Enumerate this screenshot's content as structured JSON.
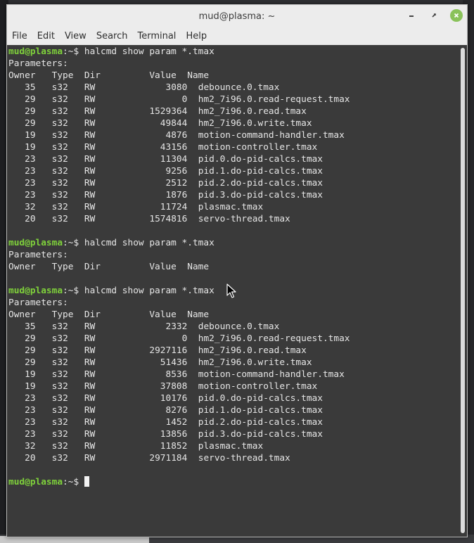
{
  "window": {
    "title": "mud@plasma: ~"
  },
  "menu": [
    "File",
    "Edit",
    "View",
    "Search",
    "Terminal",
    "Help"
  ],
  "prompt": {
    "user_host": "mud@plasma",
    "path": ":~$ "
  },
  "blocks": [
    {
      "command": "halcmd show param *.tmax",
      "params_label": "Parameters:",
      "header": "Owner   Type  Dir         Value  Name",
      "rows": [
        {
          "owner": "35",
          "type": "s32",
          "dir": "RW",
          "value": "3080",
          "name": "debounce.0.tmax"
        },
        {
          "owner": "29",
          "type": "s32",
          "dir": "RW",
          "value": "0",
          "name": "hm2_7i96.0.read-request.tmax"
        },
        {
          "owner": "29",
          "type": "s32",
          "dir": "RW",
          "value": "1529364",
          "name": "hm2_7i96.0.read.tmax"
        },
        {
          "owner": "29",
          "type": "s32",
          "dir": "RW",
          "value": "49844",
          "name": "hm2_7i96.0.write.tmax"
        },
        {
          "owner": "19",
          "type": "s32",
          "dir": "RW",
          "value": "4876",
          "name": "motion-command-handler.tmax"
        },
        {
          "owner": "19",
          "type": "s32",
          "dir": "RW",
          "value": "43156",
          "name": "motion-controller.tmax"
        },
        {
          "owner": "23",
          "type": "s32",
          "dir": "RW",
          "value": "11304",
          "name": "pid.0.do-pid-calcs.tmax"
        },
        {
          "owner": "23",
          "type": "s32",
          "dir": "RW",
          "value": "9256",
          "name": "pid.1.do-pid-calcs.tmax"
        },
        {
          "owner": "23",
          "type": "s32",
          "dir": "RW",
          "value": "2512",
          "name": "pid.2.do-pid-calcs.tmax"
        },
        {
          "owner": "23",
          "type": "s32",
          "dir": "RW",
          "value": "1876",
          "name": "pid.3.do-pid-calcs.tmax"
        },
        {
          "owner": "32",
          "type": "s32",
          "dir": "RW",
          "value": "11724",
          "name": "plasmac.tmax"
        },
        {
          "owner": "20",
          "type": "s32",
          "dir": "RW",
          "value": "1574816",
          "name": "servo-thread.tmax"
        }
      ]
    },
    {
      "command": "halcmd show param *.tmax",
      "params_label": "Parameters:",
      "header": "Owner   Type  Dir         Value  Name",
      "rows": []
    },
    {
      "command": "halcmd show param *.tmax",
      "params_label": "Parameters:",
      "header": "Owner   Type  Dir         Value  Name",
      "rows": [
        {
          "owner": "35",
          "type": "s32",
          "dir": "RW",
          "value": "2332",
          "name": "debounce.0.tmax"
        },
        {
          "owner": "29",
          "type": "s32",
          "dir": "RW",
          "value": "0",
          "name": "hm2_7i96.0.read-request.tmax"
        },
        {
          "owner": "29",
          "type": "s32",
          "dir": "RW",
          "value": "2927116",
          "name": "hm2_7i96.0.read.tmax"
        },
        {
          "owner": "29",
          "type": "s32",
          "dir": "RW",
          "value": "51436",
          "name": "hm2_7i96.0.write.tmax"
        },
        {
          "owner": "19",
          "type": "s32",
          "dir": "RW",
          "value": "8536",
          "name": "motion-command-handler.tmax"
        },
        {
          "owner": "19",
          "type": "s32",
          "dir": "RW",
          "value": "37808",
          "name": "motion-controller.tmax"
        },
        {
          "owner": "23",
          "type": "s32",
          "dir": "RW",
          "value": "10176",
          "name": "pid.0.do-pid-calcs.tmax"
        },
        {
          "owner": "23",
          "type": "s32",
          "dir": "RW",
          "value": "8276",
          "name": "pid.1.do-pid-calcs.tmax"
        },
        {
          "owner": "23",
          "type": "s32",
          "dir": "RW",
          "value": "1452",
          "name": "pid.2.do-pid-calcs.tmax"
        },
        {
          "owner": "23",
          "type": "s32",
          "dir": "RW",
          "value": "13856",
          "name": "pid.3.do-pid-calcs.tmax"
        },
        {
          "owner": "32",
          "type": "s32",
          "dir": "RW",
          "value": "11852",
          "name": "plasmac.tmax"
        },
        {
          "owner": "20",
          "type": "s32",
          "dir": "RW",
          "value": "2971184",
          "name": "servo-thread.tmax"
        }
      ]
    }
  ],
  "colors": {
    "terminal_bg": "#3a3a3a",
    "prompt_user": "#7fd13b",
    "text": "#e6e6e6",
    "close_button": "#8ac25a"
  },
  "icons": {
    "minimize": "minimize-icon",
    "maximize": "maximize-icon",
    "close": "close-icon",
    "pointer": "mouse-pointer-icon"
  }
}
